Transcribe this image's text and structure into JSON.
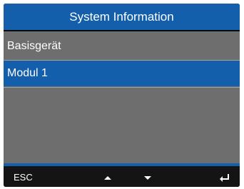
{
  "screen": {
    "title": "System Information"
  },
  "menu": {
    "items": [
      {
        "label": "Basisgerät",
        "selected": false
      },
      {
        "label": "Modul 1",
        "selected": true
      }
    ]
  },
  "footer": {
    "esc_label": "ESC",
    "up_icon": "arrow-up-icon",
    "down_icon": "arrow-down-icon",
    "enter_icon": "enter-return-icon"
  },
  "colors": {
    "accent": "#135fab",
    "menu_background": "#6e6e6e",
    "bezel": "#0a0a0a",
    "footer_background": "#141414",
    "text": "#ffffff"
  }
}
